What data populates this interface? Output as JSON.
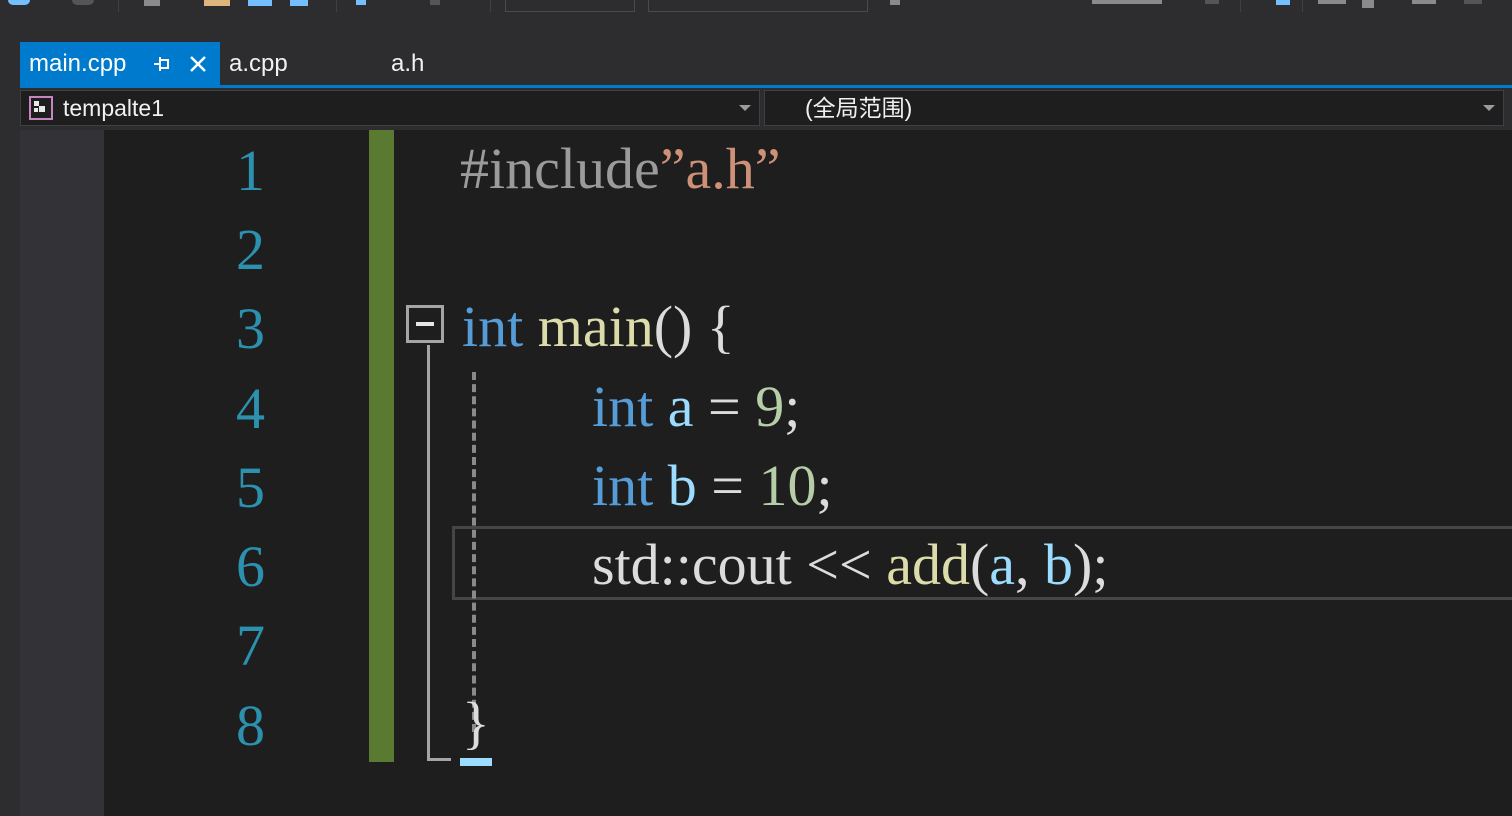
{
  "tabs": [
    {
      "label": "main.cpp",
      "active": true
    },
    {
      "label": "a.cpp",
      "active": false
    },
    {
      "label": "a.h",
      "active": false
    }
  ],
  "navbar": {
    "project": "tempalte1",
    "scope": "(全局范围)"
  },
  "line_numbers": [
    "1",
    "2",
    "3",
    "4",
    "5",
    "6",
    "7",
    "8"
  ],
  "code": {
    "line1": {
      "include": "#include",
      "file": "”a.h”"
    },
    "line3": {
      "type": "int",
      "name": "main",
      "rest": "() {"
    },
    "line4": {
      "type": "int",
      "var": "a",
      "op": " = ",
      "num": "9",
      "end": ";"
    },
    "line5": {
      "type": "int",
      "var": "b",
      "op": " = ",
      "num": "10",
      "end": ";"
    },
    "line6": {
      "ns": "std::cout << ",
      "fn": "add",
      "open": "(",
      "a": "a",
      "comma": ", ",
      "b": "b",
      "close": ");"
    },
    "line8": {
      "brace": "}"
    }
  },
  "colors": {
    "accent": "#007acc",
    "keyword": "#569cd6",
    "function": "#dcdcaa",
    "string": "#ce9178",
    "variable": "#9cdcfe",
    "number": "#b5cea8",
    "line_number": "#2b91af",
    "change_bar": "#5a7a32"
  }
}
